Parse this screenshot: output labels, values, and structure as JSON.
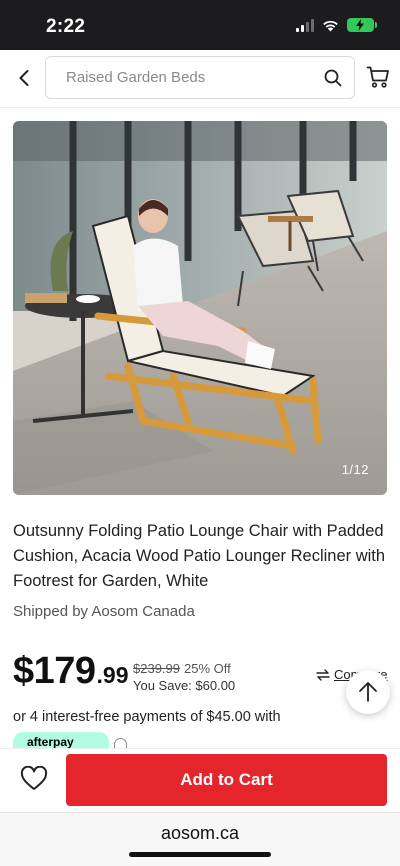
{
  "status_bar": {
    "time": "2:22"
  },
  "header": {
    "search_placeholder": "Raised Garden Beds"
  },
  "gallery": {
    "counter": "1/12"
  },
  "product": {
    "title": "Outsunny Folding Patio Lounge Chair with Padded Cushion, Acacia Wood Patio Lounger Recliner with Footrest for Garden, White",
    "shipped_by": "Shipped by Aosom Canada",
    "price_whole": "$179",
    "price_cents": ".99",
    "original_price": "$239.99",
    "discount": "25% Off",
    "you_save": "You Save: $60.00",
    "compare_label": "Compare",
    "installments": "or 4 interest-free payments of $45.00 with",
    "afterpay_label": "afterpay"
  },
  "actions": {
    "add_to_cart": "Add to Cart"
  },
  "browser": {
    "url": "aosom.ca"
  },
  "colors": {
    "accent": "#e4262c",
    "afterpay": "#b2fce4",
    "status_bar": "#1c1c1e"
  }
}
